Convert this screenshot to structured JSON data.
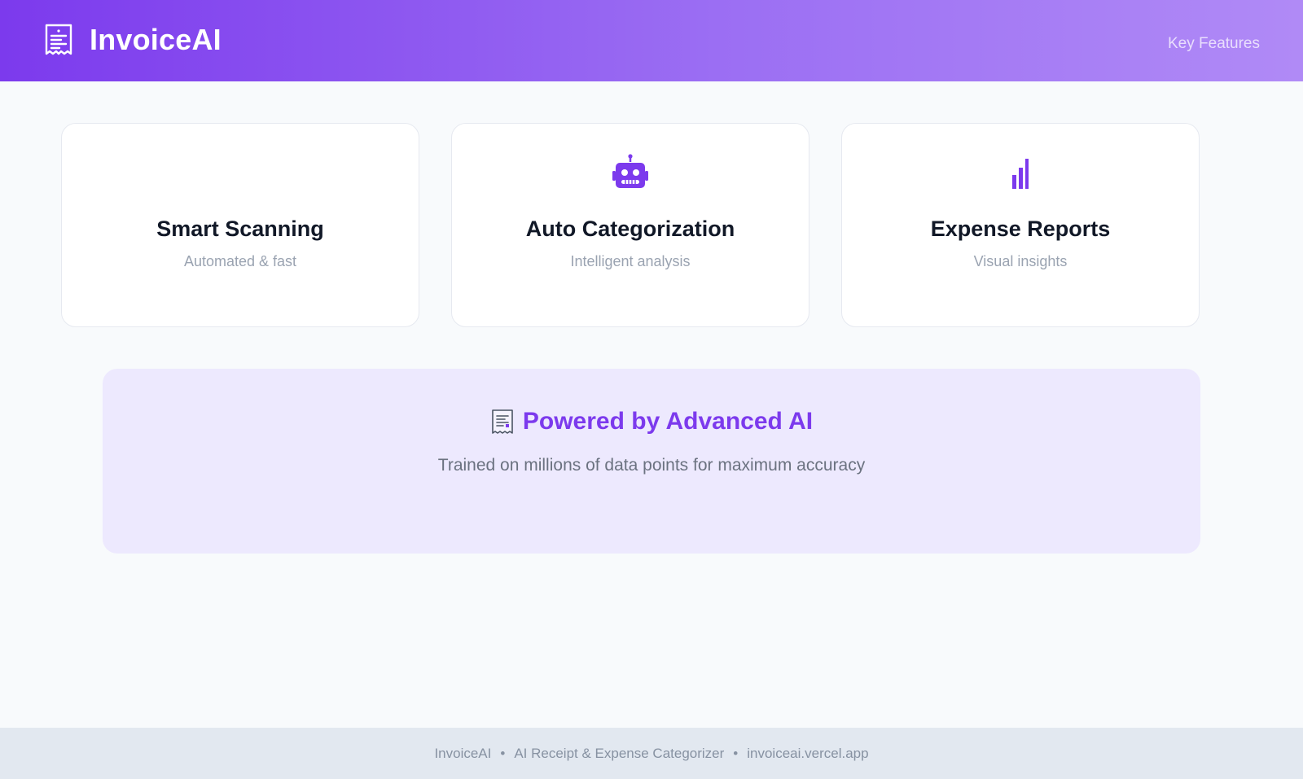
{
  "header": {
    "brand_name": "InvoiceAI",
    "brand_icon": "receipt-icon",
    "nav_link": "Key Features"
  },
  "features": [
    {
      "icon": "",
      "title": "Smart Scanning",
      "subtitle": "Automated & fast"
    },
    {
      "icon": "robot-icon",
      "title": "Auto Categorization",
      "subtitle": "Intelligent analysis"
    },
    {
      "icon": "bar-chart-icon",
      "title": "Expense Reports",
      "subtitle": "Visual insights"
    }
  ],
  "banner": {
    "icon": "receipt-icon",
    "title": "Powered by Advanced AI",
    "subtitle": "Trained on millions of data points for maximum accuracy"
  },
  "footer": {
    "brand": "InvoiceAI",
    "tagline": "AI Receipt & Expense Categorizer",
    "url": "invoiceai.vercel.app",
    "separator": "•"
  },
  "colors": {
    "accent": "#7c3aed",
    "header_gradient_start": "#7c3aed",
    "header_gradient_end": "#b08af6",
    "banner_bg": "#ede9fe",
    "page_bg": "#f8fafc",
    "footer_bg": "#e2e8f0"
  }
}
